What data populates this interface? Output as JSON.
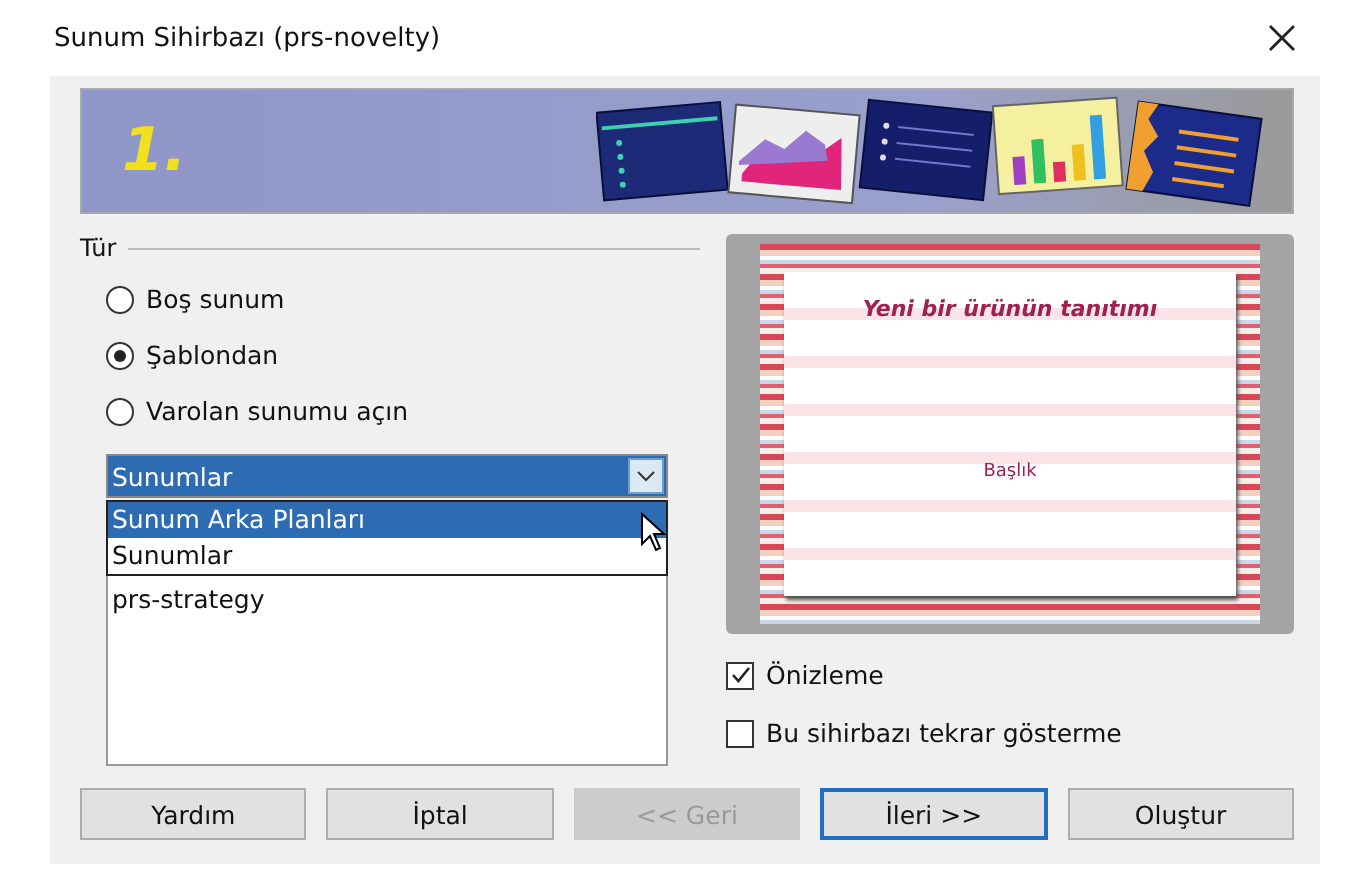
{
  "window": {
    "title": "Sunum Sihirbazı (prs-novelty)"
  },
  "banner": {
    "step": "1."
  },
  "type_group": {
    "label": "Tür",
    "options": [
      {
        "label": "Boş sunum",
        "selected": false
      },
      {
        "label": "Şablondan",
        "selected": true
      },
      {
        "label": "Varolan sunumu açın",
        "selected": false
      }
    ]
  },
  "category_combo": {
    "value": "Sunumlar",
    "options": [
      {
        "label": "Sunum Arka Planları",
        "highlighted": true
      },
      {
        "label": "Sunumlar",
        "highlighted": false
      }
    ]
  },
  "template_list": {
    "items": [
      "prs-strategy"
    ]
  },
  "preview": {
    "title": "Yeni bir ürünün tanıtımı",
    "subtitle": "Başlık"
  },
  "checkboxes": [
    {
      "label": "Önizleme",
      "checked": true
    },
    {
      "label": "Bu sihirbazı tekrar gösterme",
      "checked": false
    }
  ],
  "buttons": [
    {
      "label": "Yardım",
      "disabled": false,
      "default": false
    },
    {
      "label": "İptal",
      "disabled": false,
      "default": false
    },
    {
      "label": "<< Geri",
      "disabled": true,
      "default": false
    },
    {
      "label": "İleri >>",
      "disabled": false,
      "default": true
    },
    {
      "label": "Oluştur",
      "disabled": false,
      "default": false
    }
  ]
}
